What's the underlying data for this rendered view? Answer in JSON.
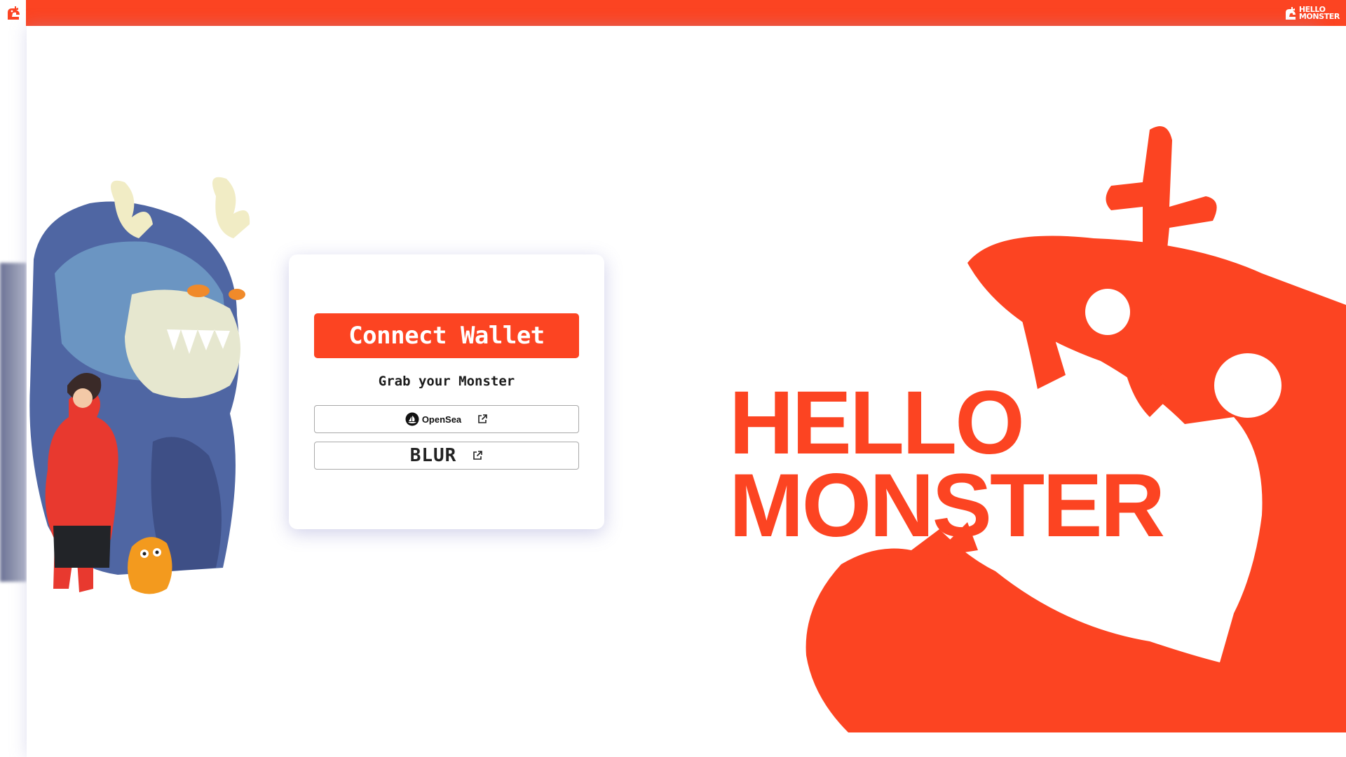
{
  "brand": {
    "name_line1": "HELLO",
    "name_line2": "MONSTER",
    "accent_color": "#fc4422"
  },
  "topbar": {
    "corner_icon": "monster-logo-icon",
    "logo_line1": "HELLO",
    "logo_line2": "MONSTER"
  },
  "hero": {
    "title_line1": "HELLO",
    "title_line2": "MONSTER",
    "illustration": "monster-and-hero-illustration",
    "mascot": "big-monster-mascot"
  },
  "card": {
    "connect_label": "Connect Wallet",
    "subtitle": "Grab your Monster",
    "markets": [
      {
        "label": "OpenSea",
        "icon": "opensea-icon",
        "link_icon": "external-link-icon"
      },
      {
        "label": "BLUR",
        "icon": "blur-logo",
        "link_icon": "external-link-icon"
      }
    ]
  }
}
